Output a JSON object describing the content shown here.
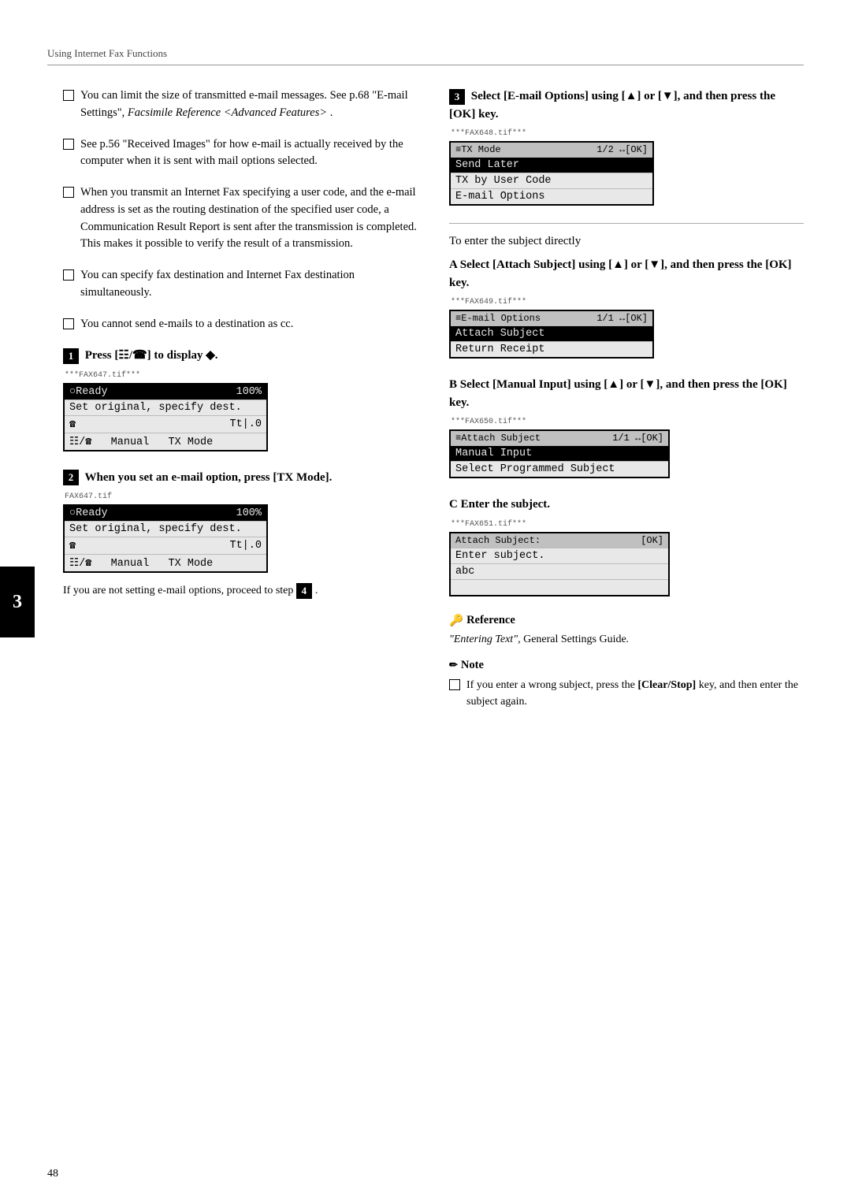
{
  "header": {
    "title": "Using Internet Fax Functions"
  },
  "page_number": "48",
  "chapter_number": "3",
  "left_column": {
    "bullets": [
      {
        "id": "bullet1",
        "text": "You can limit the size of transmitted e-mail messages. See p.68 “E-mail Settings”, Facsimile Reference <Advanced Features> ."
      },
      {
        "id": "bullet2",
        "text": "See p.56 “Received Images” for how e-mail is actually received by the computer when it is sent with mail options selected."
      },
      {
        "id": "bullet3",
        "text": "When you transmit an Internet Fax specifying a user code, and the e-mail address is set as the routing destination of the specified user code, a Communication Result Report is sent after the transmission is completed. This makes it possible to verify the result of a transmission."
      },
      {
        "id": "bullet4",
        "text": "You can specify fax destination and Internet Fax destination simultaneously."
      },
      {
        "id": "bullet5",
        "text": "You cannot send e-mails to a destination as cc."
      }
    ],
    "step1": {
      "header": "Press [☷/☎] to display ◆.",
      "file_label": "***FAX647.tif***",
      "lcd": {
        "rows": [
          {
            "left": "○Ready",
            "right": "100%",
            "style": "highlighted"
          },
          {
            "left": "Set original, specify dest.",
            "right": "",
            "style": "normal"
          },
          {
            "left": "☎",
            "right": "Tt|.0",
            "style": "normal"
          },
          {
            "left": "☷/☎   Manual   TX Mode",
            "right": "",
            "style": "normal"
          }
        ]
      }
    },
    "step2": {
      "header": "When you set an e-mail option, press [TX Mode].",
      "file_label": "FAX647.tif",
      "lcd": {
        "rows": [
          {
            "left": "○Ready",
            "right": "100%",
            "style": "highlighted"
          },
          {
            "left": "Set original, specify dest.",
            "right": "",
            "style": "normal"
          },
          {
            "left": "☎",
            "right": "Tt|.0",
            "style": "normal"
          },
          {
            "left": "☷/☎   Manual   TX Mode",
            "right": "",
            "style": "normal"
          }
        ]
      },
      "note": "If you are not setting e-mail options, proceed to step ④."
    }
  },
  "right_column": {
    "step3": {
      "header": "Select [E-mail Options] using [▲] or [▼], and then press the [OK] key.",
      "file_label": "***FAX648.tif***",
      "lcd": {
        "rows": [
          {
            "left": "≡TX Mode",
            "right": "1/2 ↔[OK]",
            "style": "top-row"
          },
          {
            "left": "Send Later",
            "right": "",
            "style": "highlighted"
          },
          {
            "left": "TX by User Code",
            "right": "",
            "style": "normal"
          },
          {
            "left": "E-mail Options",
            "right": "",
            "style": "normal"
          }
        ]
      }
    },
    "divider": true,
    "to_enter_label": "To enter the subject directly",
    "stepA": {
      "header": "Select [Attach Subject] using [▲] or [▼], and then press the [OK] key.",
      "file_label": "***FAX649.tif***",
      "lcd": {
        "rows": [
          {
            "left": "≡E-mail Options",
            "right": "1/1 ↔[OK]",
            "style": "top-row"
          },
          {
            "left": "Attach Subject",
            "right": "",
            "style": "highlighted"
          },
          {
            "left": "Return Receipt",
            "right": "",
            "style": "normal"
          }
        ]
      }
    },
    "stepB": {
      "header": "Select [Manual Input] using [▲] or [▼], and then press the [OK] key.",
      "file_label": "***FAX650.tif***",
      "lcd": {
        "rows": [
          {
            "left": "≡Attach Subject",
            "right": "1/1 ↔[OK]",
            "style": "top-row"
          },
          {
            "left": "Manual Input",
            "right": "",
            "style": "highlighted"
          },
          {
            "left": "Select Programmed Subject",
            "right": "",
            "style": "normal"
          }
        ]
      }
    },
    "stepC": {
      "header": "Enter the subject.",
      "file_label": "***FAX651.tif***",
      "lcd": {
        "rows": [
          {
            "left": "Attach Subject:",
            "right": "[OK]",
            "style": "top-row"
          },
          {
            "left": "Enter subject.",
            "right": "",
            "style": "normal"
          },
          {
            "left": "abc",
            "right": "",
            "style": "normal"
          },
          {
            "left": "",
            "right": "",
            "style": "normal"
          }
        ]
      }
    },
    "reference": {
      "header": "Reference",
      "text": "“Entering Text”, General Settings Guide."
    },
    "note": {
      "header": "Note",
      "bullets": [
        "If you enter a wrong subject, press the [Clear/Stop] key, and then enter the subject again."
      ]
    }
  }
}
